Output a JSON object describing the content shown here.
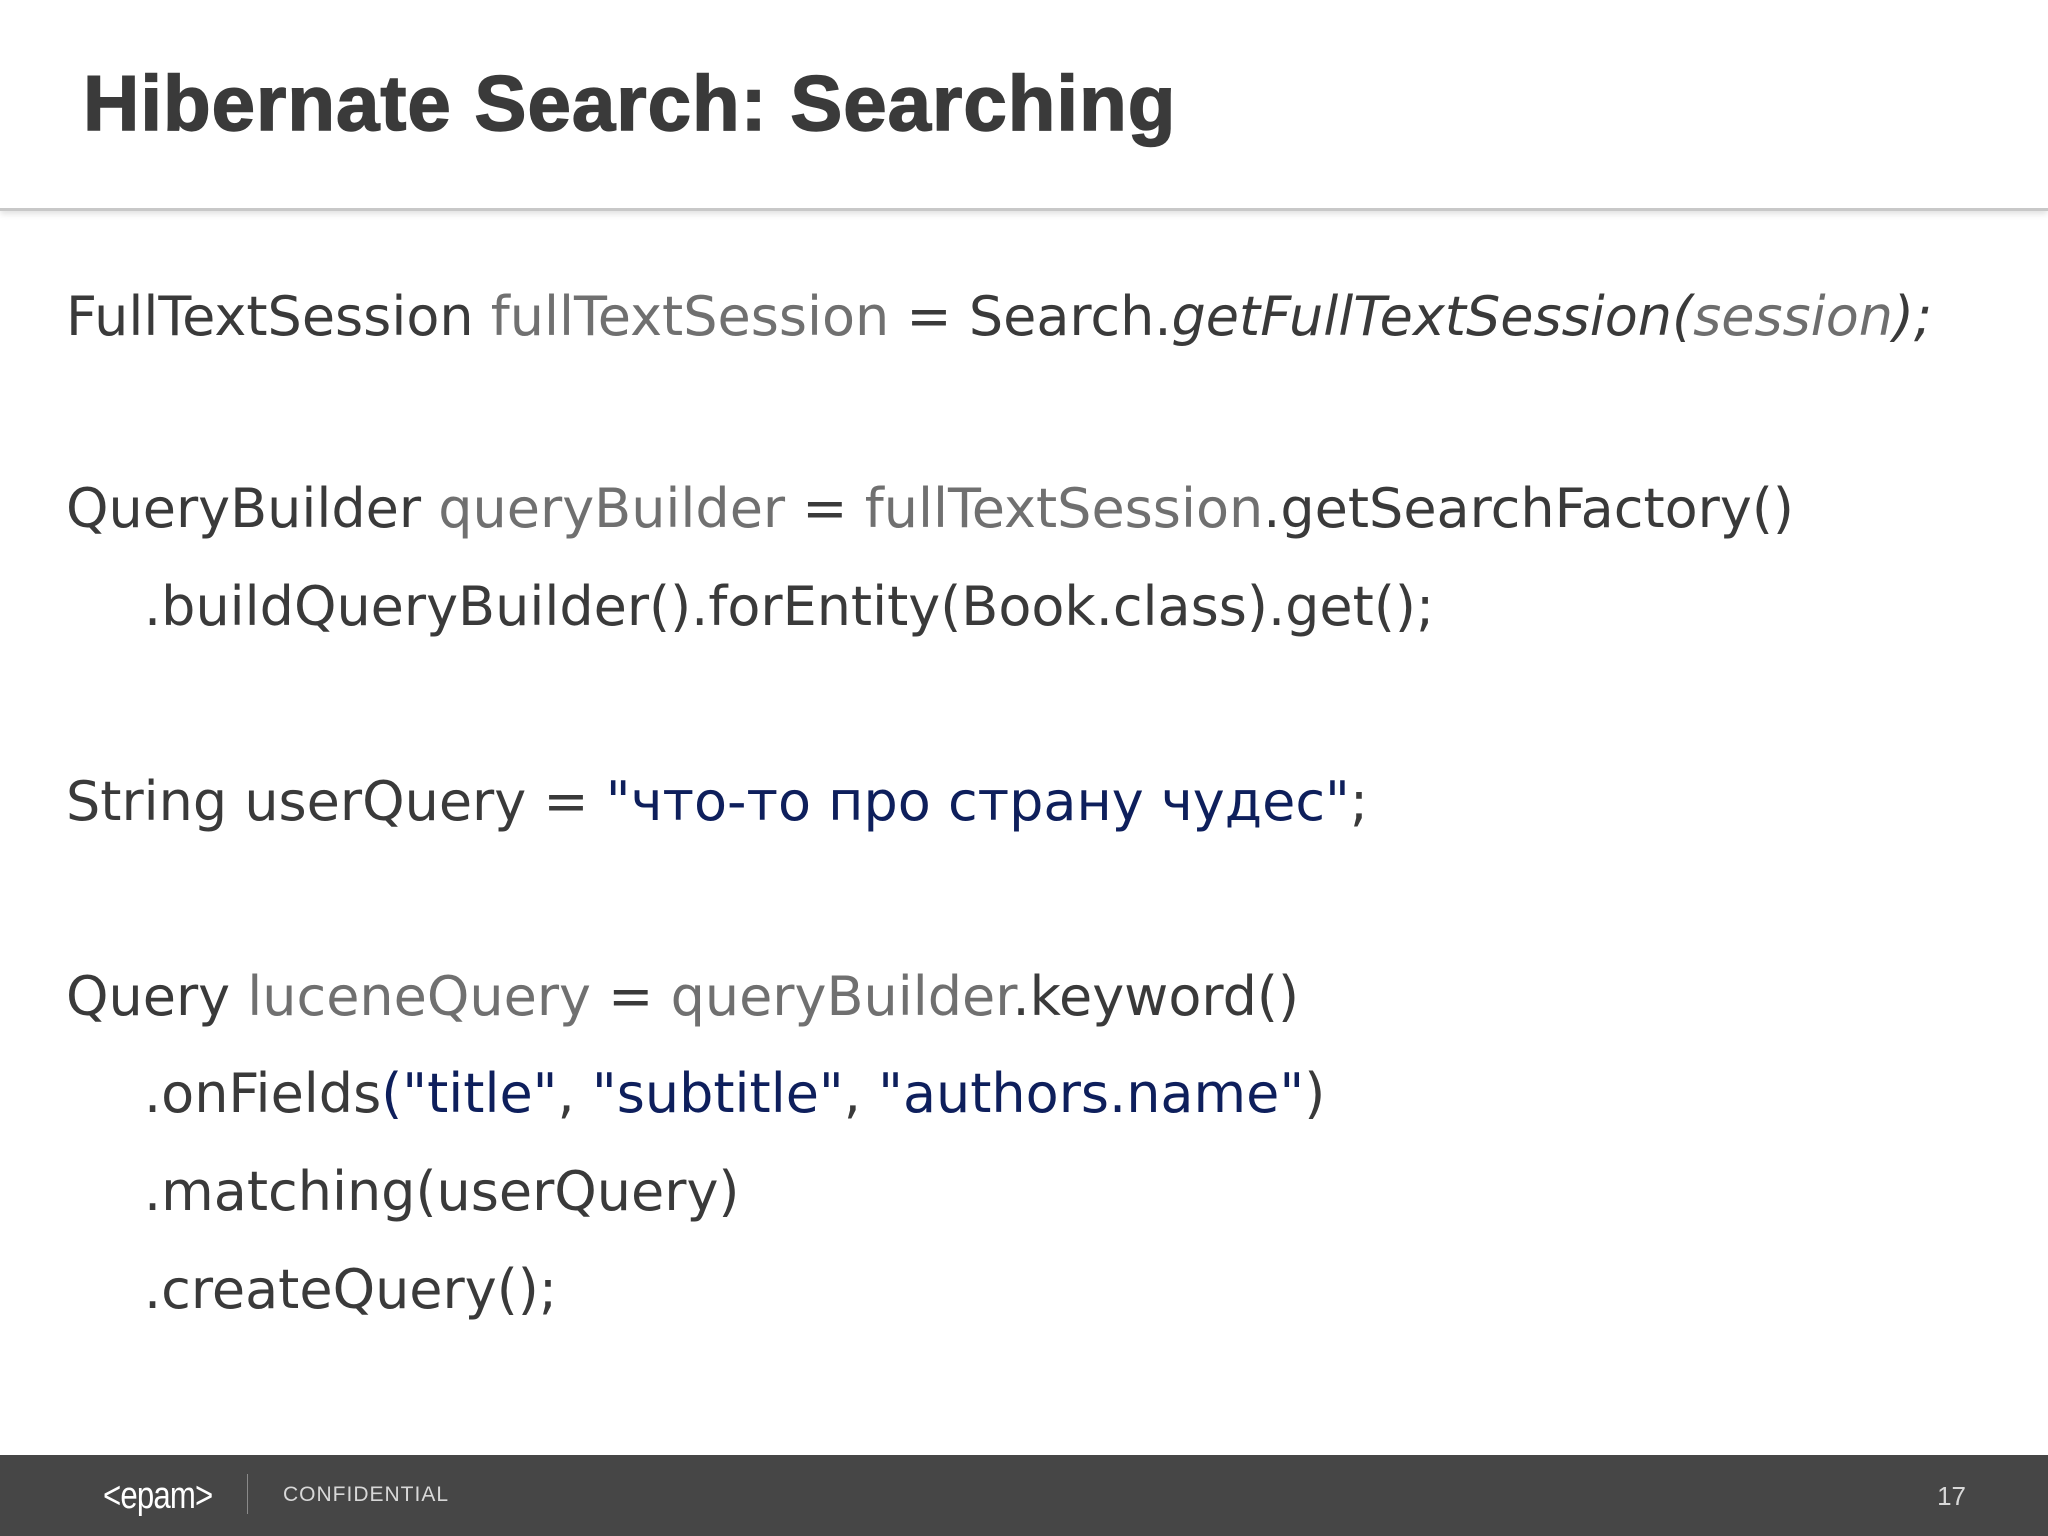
{
  "slide": {
    "title": "Hibernate Search: Searching",
    "code_lines": [
      {
        "tokens": [
          {
            "text": "FullTextSession ",
            "style": "type"
          },
          {
            "text": "fullTextSession",
            "style": "var"
          },
          {
            "text": " = Search.",
            "style": "plain"
          },
          {
            "text": "getFullTextSession(",
            "style": "italic"
          },
          {
            "text": "session",
            "style": "italic-light"
          },
          {
            "text": ");",
            "style": "italic"
          }
        ]
      },
      {
        "tokens": [
          {
            "text": "QueryBuilder ",
            "style": "type"
          },
          {
            "text": "queryBuilder",
            "style": "var"
          },
          {
            "text": " = ",
            "style": "plain"
          },
          {
            "text": "fullTextSession",
            "style": "var"
          },
          {
            "text": ".getSearchFactory()",
            "style": "plain"
          }
        ]
      },
      {
        "tokens": [
          {
            "text": ".buildQueryBuilder().forEntity(Book.class).get();",
            "style": "plain"
          }
        ]
      },
      {
        "tokens": [
          {
            "text": "String userQuery = ",
            "style": "plain"
          },
          {
            "text": "\"что-то про страну чудес\"",
            "style": "str"
          },
          {
            "text": ";",
            "style": "plain"
          }
        ]
      },
      {
        "tokens": [
          {
            "text": "Query ",
            "style": "type"
          },
          {
            "text": "luceneQuery",
            "style": "var"
          },
          {
            "text": " = ",
            "style": "plain"
          },
          {
            "text": "queryBuilder",
            "style": "var"
          },
          {
            "text": ".keyword()",
            "style": "plain"
          }
        ]
      },
      {
        "tokens": [
          {
            "text": ".onFields",
            "style": "plain"
          },
          {
            "text": "(\"title\"",
            "style": "str"
          },
          {
            "text": ", ",
            "style": "plain"
          },
          {
            "text": "\"subtitle\"",
            "style": "str"
          },
          {
            "text": ", ",
            "style": "plain"
          },
          {
            "text": "\"authors.name\"",
            "style": "str"
          },
          {
            "text": ")",
            "style": "plain"
          }
        ]
      },
      {
        "tokens": [
          {
            "text": ".matching(userQuery)",
            "style": "plain"
          }
        ]
      },
      {
        "tokens": [
          {
            "text": ".createQuery();",
            "style": "plain"
          }
        ]
      }
    ]
  },
  "footer": {
    "logo": "<epam>",
    "label": "CONFIDENTIAL",
    "page_number": "17"
  },
  "colors": {
    "footer_bg": "#464646",
    "string_literal": "#0e1f5c",
    "variable": "#707070",
    "text": "#3a3a3a"
  }
}
